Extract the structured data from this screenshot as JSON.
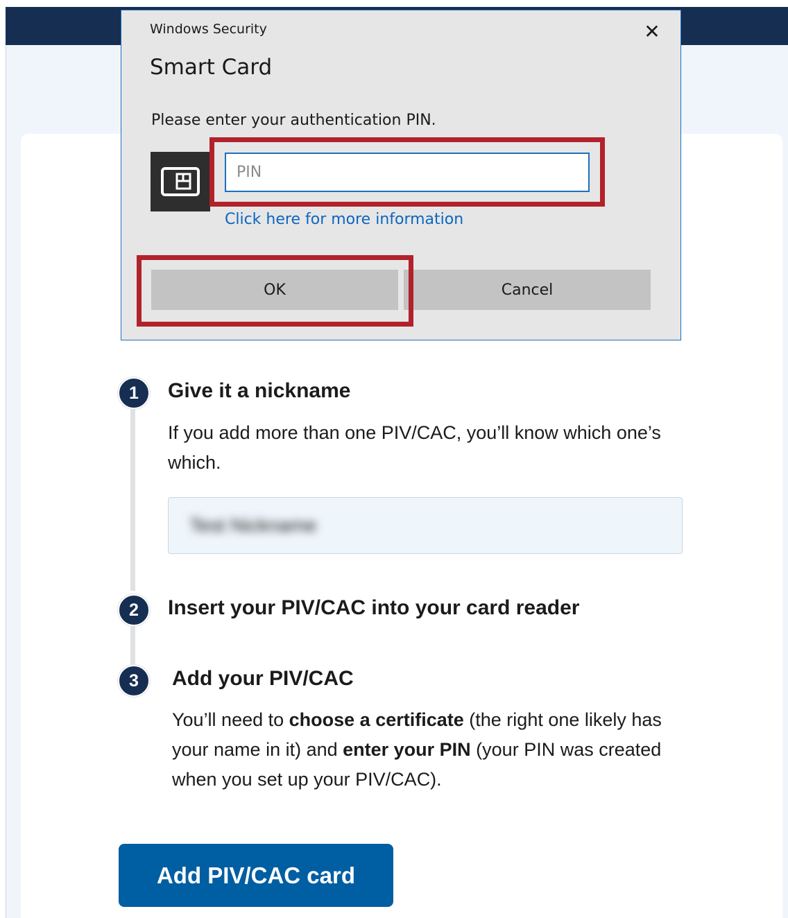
{
  "dialog": {
    "window_title": "Windows Security",
    "heading": "Smart Card",
    "prompt": "Please enter your authentication PIN.",
    "pin_placeholder": "PIN",
    "more_info_link": "Click here for more information",
    "ok_label": "OK",
    "cancel_label": "Cancel",
    "close_glyph": "✕",
    "icon": "smart-card-icon",
    "highlight_color": "#b1222b"
  },
  "steps": [
    {
      "number": "1",
      "title": "Give it a nickname",
      "body": "If you add more than one PIV/CAC, you’ll know which one’s which.",
      "input_value": "Test Nickname"
    },
    {
      "number": "2",
      "title": "Insert your PIV/CAC into your card reader"
    },
    {
      "number": "3",
      "title": "Add your PIV/CAC",
      "body_parts": [
        "You’ll need to ",
        "choose a certificate",
        " (the right one likely has your name in it) and ",
        "enter your PIN",
        " (your PIN was created when you set up your PIV/CAC)."
      ]
    }
  ],
  "primary_button": "Add PIV/CAC card",
  "colors": {
    "header": "#162e51",
    "primary": "#005ea2",
    "step_circle": "#162e51",
    "link": "#0b66c2"
  }
}
